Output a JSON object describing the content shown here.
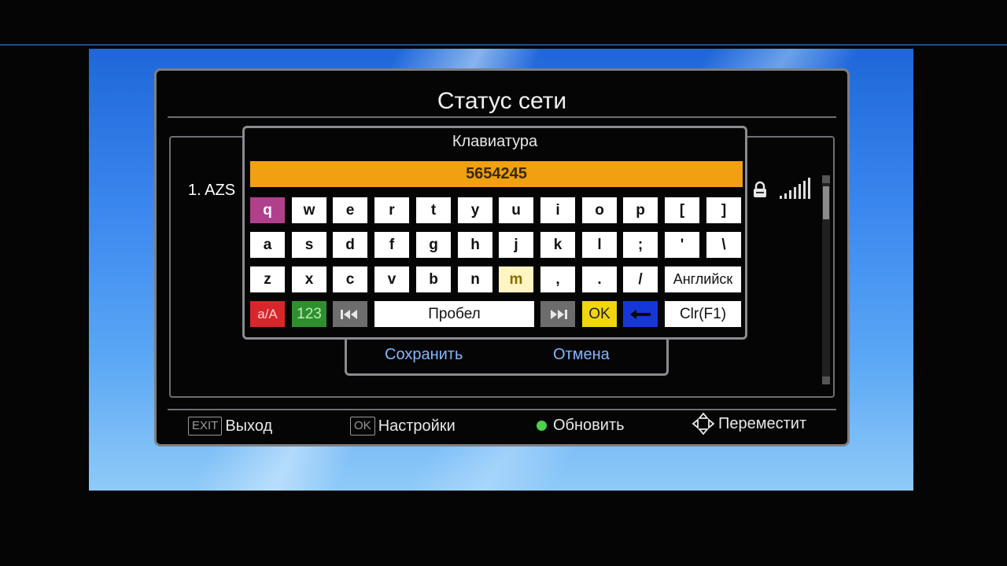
{
  "screen": {
    "title": "Статус сети",
    "network_list": [
      {
        "label": "1.  AZS"
      }
    ]
  },
  "keyboard": {
    "title": "Клавиатура",
    "input_value": "5654245",
    "rows": [
      [
        "q",
        "w",
        "e",
        "r",
        "t",
        "y",
        "u",
        "i",
        "o",
        "p",
        "[",
        "]"
      ],
      [
        "a",
        "s",
        "d",
        "f",
        "g",
        "h",
        "j",
        "k",
        "l",
        ";",
        "'",
        "\\"
      ],
      [
        "z",
        "x",
        "c",
        "v",
        "b",
        "n",
        "m",
        ",",
        ".",
        "/"
      ]
    ],
    "lang_label": "Английск",
    "case_label": "a/A",
    "num_label": "123",
    "space_label": "Пробел",
    "ok_label": "OK",
    "clear_label": "Clr(F1)"
  },
  "dialog": {
    "save_label": "Сохранить",
    "cancel_label": "Отмена"
  },
  "footer": {
    "exit_key": "EXIT",
    "exit_label": "Выход",
    "ok_key": "OK",
    "ok_label": "Настройки",
    "refresh_label": "Обновить",
    "move_label": "Переместит"
  },
  "colors": {
    "input_bar": "#f0a010",
    "selected_key": "#b0408c",
    "case_key": "#d8262a",
    "num_key": "#2f8f2f",
    "ok_key": "#f1d60c",
    "backspace_key": "#1637d8",
    "dialog_text": "#82b6ff"
  }
}
